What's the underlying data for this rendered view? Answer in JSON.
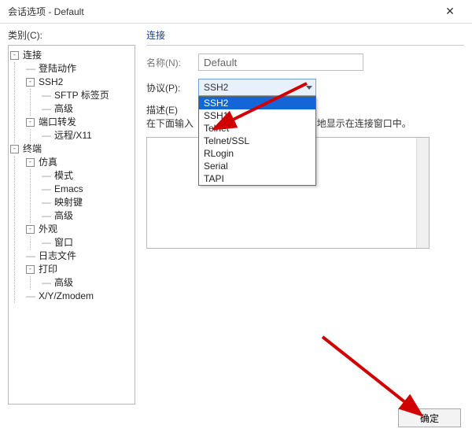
{
  "window": {
    "title": "会话选项 - Default",
    "close_glyph": "✕"
  },
  "left_label": "类别(C):",
  "tree": {
    "n0": {
      "label": "连接"
    },
    "n0_0": {
      "label": "登陆动作"
    },
    "n0_1": {
      "label": "SSH2"
    },
    "n0_1_0": {
      "label": "SFTP 标签页"
    },
    "n0_1_1": {
      "label": "高级"
    },
    "n0_2": {
      "label": "端口转发"
    },
    "n0_2_0": {
      "label": "远程/X11"
    },
    "n1": {
      "label": "终端"
    },
    "n1_0": {
      "label": "仿真"
    },
    "n1_0_0": {
      "label": "模式"
    },
    "n1_0_1": {
      "label": "Emacs"
    },
    "n1_0_2": {
      "label": "映射键"
    },
    "n1_0_3": {
      "label": "高级"
    },
    "n1_1": {
      "label": "外观"
    },
    "n1_1_0": {
      "label": "窗口"
    },
    "n1_2": {
      "label": "日志文件"
    },
    "n1_3": {
      "label": "打印"
    },
    "n1_3_0": {
      "label": "高级"
    },
    "n1_4": {
      "label": "X/Y/Zmodem"
    }
  },
  "section": {
    "title": "连接",
    "name_label": "名称(N):",
    "name_value": "Default",
    "protocol_label": "协议(P):",
    "protocol_value": "SSH2",
    "desc_label": "描述(E)",
    "desc_hint_a": "在下面输入",
    "desc_hint_b": "地显示在连接窗口中。"
  },
  "protocol_options": {
    "o0": "SSH2",
    "o1": "SSH1",
    "o2": "Telnet",
    "o3": "Telnet/SSL",
    "o4": "RLogin",
    "o5": "Serial",
    "o6": "TAPI"
  },
  "footer": {
    "ok_label": "确定"
  }
}
